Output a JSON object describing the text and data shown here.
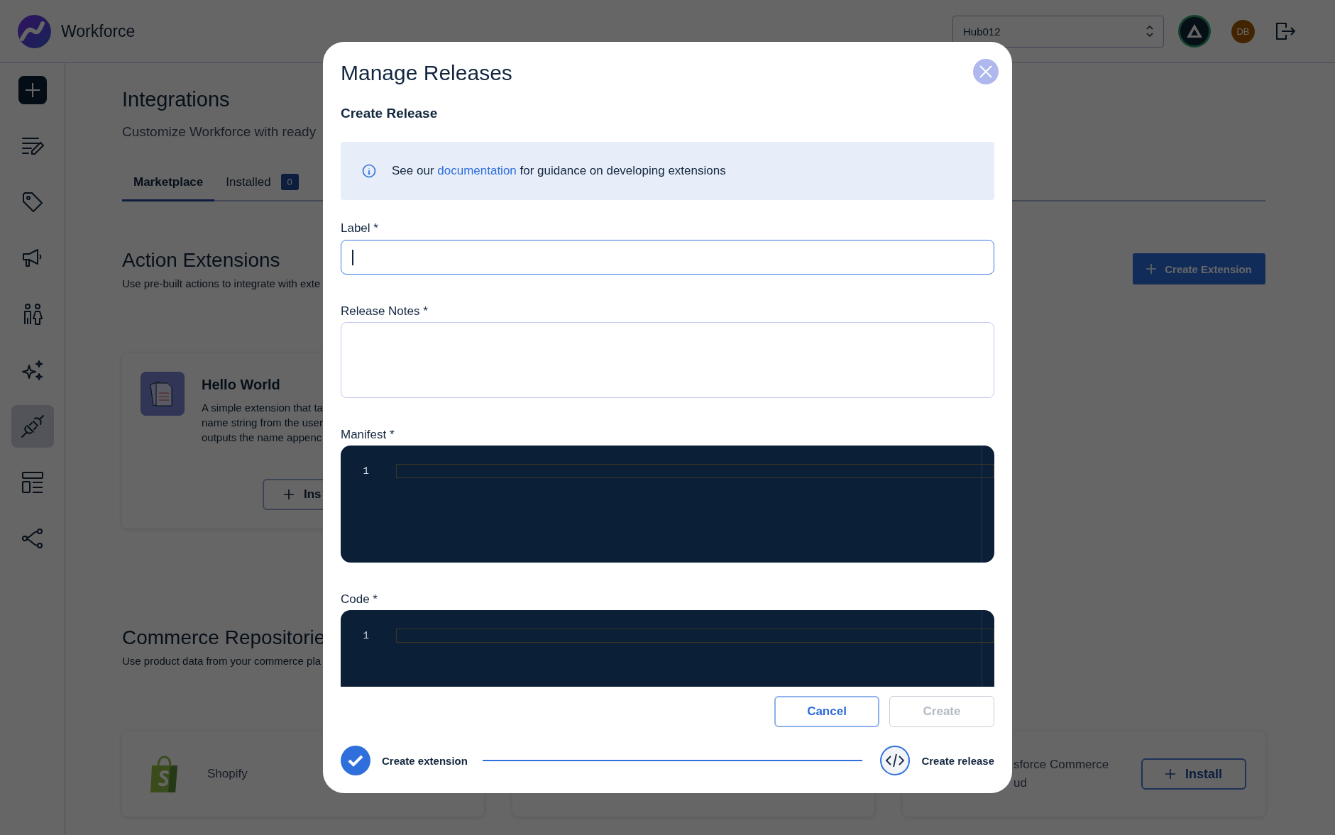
{
  "app": {
    "name": "Workforce"
  },
  "header": {
    "hub_select": {
      "value": "Hub012"
    },
    "user": {
      "initials": "DB"
    }
  },
  "sidebar": {
    "items": [
      {
        "kind": "add",
        "selected": false
      },
      {
        "kind": "notes",
        "selected": false
      },
      {
        "kind": "tag",
        "selected": false
      },
      {
        "kind": "megaphone",
        "selected": false
      },
      {
        "kind": "people",
        "selected": false
      },
      {
        "kind": "sparkles",
        "selected": false
      },
      {
        "kind": "plug",
        "selected": true
      },
      {
        "kind": "layout",
        "selected": false
      },
      {
        "kind": "share",
        "selected": false
      }
    ]
  },
  "page": {
    "title": "Integrations",
    "subtitle": "Customize Workforce with ready",
    "tabs": [
      {
        "label": "Marketplace",
        "selected": true
      },
      {
        "label": "Installed",
        "selected": false,
        "count": "0"
      }
    ],
    "action_extensions": {
      "title": "Action Extensions",
      "description": "Use pre-built actions to integrate with exte",
      "button": "Create Extension",
      "cards": [
        {
          "title": "Hello World",
          "description": [
            "A simple extension that ta",
            "name string from the user",
            "outputs the name appenc"
          ],
          "button": "Ins"
        }
      ]
    },
    "commerce_repositories": {
      "title": "Commerce Repositorie",
      "description": "Use product data from your commerce pla",
      "cards": [
        {
          "kind": "shopify",
          "name": [
            "Shopify"
          ]
        },
        {
          "kind": "hidden"
        },
        {
          "kind": "cut",
          "name": [
            "sforce Commerce",
            "ud"
          ],
          "button": "Install"
        }
      ]
    }
  },
  "modal": {
    "title": "Manage Releases",
    "subtitle": "Create Release",
    "info": {
      "before": "See our ",
      "link": "documentation",
      "after": " for guidance on developing extensions"
    },
    "fields": [
      {
        "kind": "input",
        "label": "Label *",
        "focused": true
      },
      {
        "kind": "textarea",
        "label": "Release Notes *",
        "focused": false
      },
      {
        "kind": "code",
        "label": "Manifest *",
        "line_numbers": [
          "1"
        ]
      },
      {
        "kind": "code",
        "label": "Code *",
        "line_numbers": [
          "1"
        ]
      }
    ],
    "buttons": [
      {
        "label": "Cancel",
        "disabled": false
      },
      {
        "label": "Create",
        "disabled": true
      }
    ],
    "steps": [
      {
        "label": "Create extension",
        "done": true
      },
      {
        "label": "Create release",
        "done": false
      }
    ]
  }
}
